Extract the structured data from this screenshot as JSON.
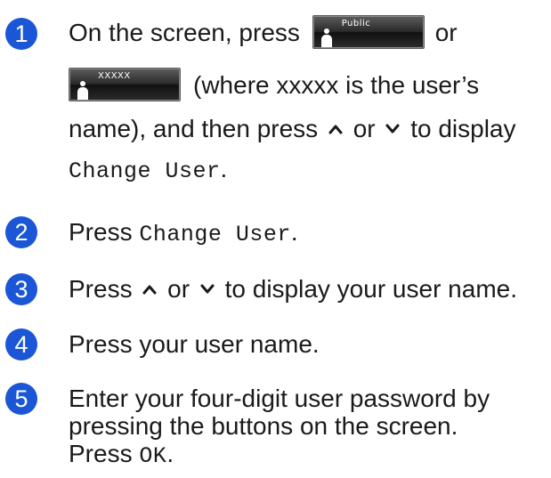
{
  "colors": {
    "badge": "#1a56d6",
    "text": "#1a1a1a"
  },
  "steps": [
    {
      "number": "1",
      "line1_prefix": "On the screen, press",
      "public_button_label": "Public",
      "line1_suffix": "or",
      "user_button_label": "XXXXX",
      "line2_suffix": "(where xxxxx is the user’s",
      "line3_prefix": "name), and then press",
      "up_icon": "chevron-up-icon",
      "or_word": "or",
      "down_icon": "chevron-down-icon",
      "line3_suffix": "to display",
      "line4_code": "Change User",
      "line4_end": "."
    },
    {
      "number": "2",
      "prefix": "Press",
      "code": "Change User",
      "end": "."
    },
    {
      "number": "3",
      "prefix": "Press",
      "or_word": "or",
      "suffix": "to display your user name."
    },
    {
      "number": "4",
      "text": "Press your user name."
    },
    {
      "number": "5",
      "line1": "Enter your four-digit user password by",
      "line2": "pressing the buttons on the screen.",
      "line3_prefix": "Press",
      "line3_code": "OK",
      "line3_end": "."
    }
  ]
}
